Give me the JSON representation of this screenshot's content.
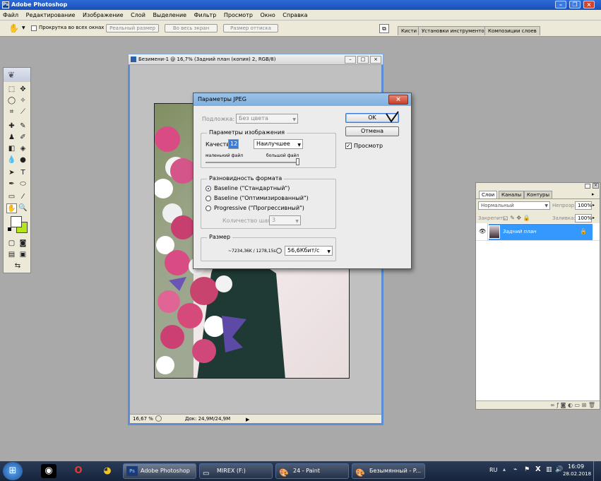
{
  "app": {
    "title": "Adobe Photoshop"
  },
  "menu": [
    "Файл",
    "Редактирование",
    "Изображение",
    "Слой",
    "Выделение",
    "Фильтр",
    "Просмотр",
    "Окно",
    "Справка"
  ],
  "options": {
    "scroll_all_label": "Прокрутка во всех окнах",
    "actual_pixels": "Реальный размер",
    "fit_screen": "Во весь экран",
    "print_size": "Размер оттиска",
    "dock_tabs": [
      "Кисти",
      "Установки инструментов",
      "Композиции слоев"
    ]
  },
  "document": {
    "title": "Безимени-1 @ 16,7% (Задний план (копия) 2, RGB/8)",
    "zoom": "16,67 %",
    "doc_size": "Док: 24,9M/24,9M"
  },
  "jpeg_dialog": {
    "title": "Параметры JPEG",
    "matte_label": "Подложка:",
    "matte_value": "Без цвета",
    "ok_label": "OK",
    "cancel_label": "Отмена",
    "preview_label": "Просмотр",
    "image_options_title": "Параметры изображения",
    "quality_label": "Качество:",
    "quality_value": "12",
    "quality_preset": "Наилучшее",
    "small_file": "маленький файл",
    "large_file": "большой файл",
    "format_title": "Разновидность формата",
    "formats": [
      "Baseline (\"Стандартный\")",
      "Baseline (\"Оптимизированный\")",
      "Progressive (\"Прогрессивный\")"
    ],
    "scans_label": "Количество шагов:",
    "scans_value": "3",
    "size_title": "Размер",
    "size_value": "~7234,36K / 1278,15s",
    "speed_value": "56,6Кбит/с"
  },
  "layers_panel": {
    "tabs": [
      "Слои",
      "Каналы",
      "Контуры"
    ],
    "blend_mode": "Нормальный",
    "opacity_label": "Непрозр.:",
    "opacity_value": "100%",
    "lock_label": "Закрепить:",
    "fill_label": "Заливка:",
    "fill_value": "100%",
    "layer_name": "Задний план"
  },
  "taskbar": {
    "tasks": [
      "Adobe Photoshop",
      "MIREX (F:)",
      "24 - Paint",
      "Безымянный - P..."
    ],
    "lang": "RU",
    "time": "16:09",
    "date": "28.02.2018"
  },
  "colors": {
    "accent": "#3399ff",
    "titlebar": "#2d6bd8",
    "fg_swatch": "#ffffff",
    "bg_swatch": "#b5e61d"
  }
}
